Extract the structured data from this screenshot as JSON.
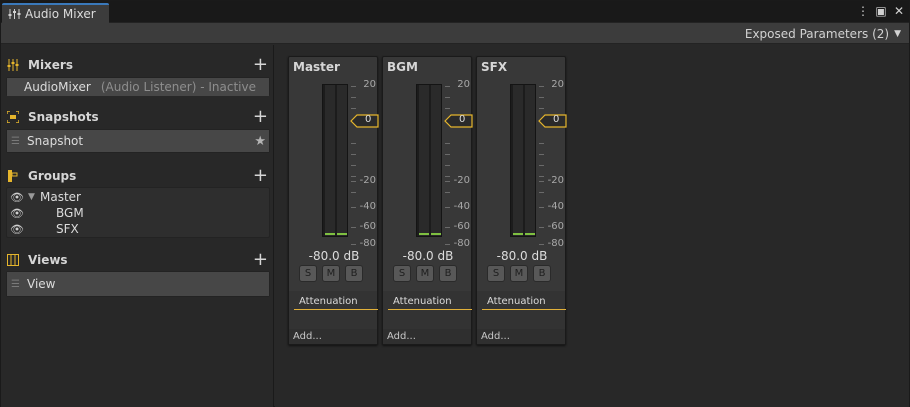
{
  "window": {
    "tab_title": "Audio Mixer",
    "controls": {
      "menu": "⋮",
      "maximize": "▣",
      "close": "✕"
    }
  },
  "toolbar": {
    "exposed_parameters": "Exposed Parameters (2)"
  },
  "sidebar": {
    "mixers": {
      "title": "Mixers",
      "items": [
        {
          "name": "AudioMixer",
          "detail": "(Audio Listener) - Inactive"
        }
      ]
    },
    "snapshots": {
      "title": "Snapshots",
      "items": [
        {
          "name": "Snapshot"
        }
      ]
    },
    "groups": {
      "title": "Groups",
      "items": [
        {
          "name": "Master"
        },
        {
          "name": "BGM"
        },
        {
          "name": "SFX"
        }
      ]
    },
    "views": {
      "title": "Views",
      "items": [
        {
          "name": "View"
        }
      ]
    }
  },
  "strips": [
    {
      "name": "Master",
      "db": "-80.0 dB",
      "fader_value": "0",
      "effect": "Attenuation",
      "add": "Add..."
    },
    {
      "name": "BGM",
      "db": "-80.0 dB",
      "fader_value": "0",
      "effect": "Attenuation",
      "add": "Add..."
    },
    {
      "name": "SFX",
      "db": "-80.0 dB",
      "fader_value": "0",
      "effect": "Attenuation",
      "add": "Add..."
    }
  ],
  "meter_scale": [
    "20",
    "-20",
    "-40",
    "-60",
    "-80"
  ],
  "buttons": {
    "solo": "S",
    "mute": "M",
    "bypass": "B"
  },
  "colors": {
    "accent": "#e5b52c",
    "meter_level": "#7fc041",
    "tab_highlight": "#3a79bb"
  }
}
